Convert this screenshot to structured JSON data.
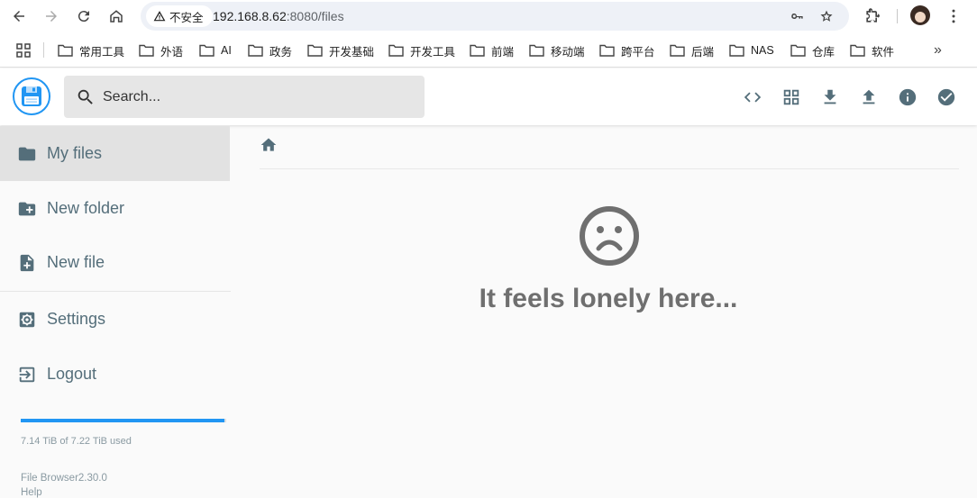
{
  "browser": {
    "security_label": "不安全",
    "url_host": "192.168.8.62",
    "url_path": ":8080/files"
  },
  "bookmarks": [
    "常用工具",
    "外语",
    "AI",
    "政务",
    "开发基础",
    "开发工具",
    "前端",
    "移动端",
    "跨平台",
    "后端",
    "NAS",
    "仓库",
    "软件"
  ],
  "header": {
    "search_placeholder": "Search..."
  },
  "sidebar": {
    "items": [
      {
        "label": "My files",
        "icon": "folder-icon"
      },
      {
        "label": "New folder",
        "icon": "create-folder-icon"
      },
      {
        "label": "New file",
        "icon": "note-add-icon"
      },
      {
        "label": "Settings",
        "icon": "settings-icon"
      },
      {
        "label": "Logout",
        "icon": "logout-icon"
      }
    ],
    "usage_text": "7.14 TiB of 7.22 TiB used",
    "usage_fraction": 0.99,
    "version": "File Browser2.30.0",
    "help": "Help"
  },
  "main": {
    "empty_message": "It feels lonely here..."
  },
  "colors": {
    "accent": "#2196f3",
    "text": "#546e7a",
    "active_bg": "#e2e2e2"
  }
}
